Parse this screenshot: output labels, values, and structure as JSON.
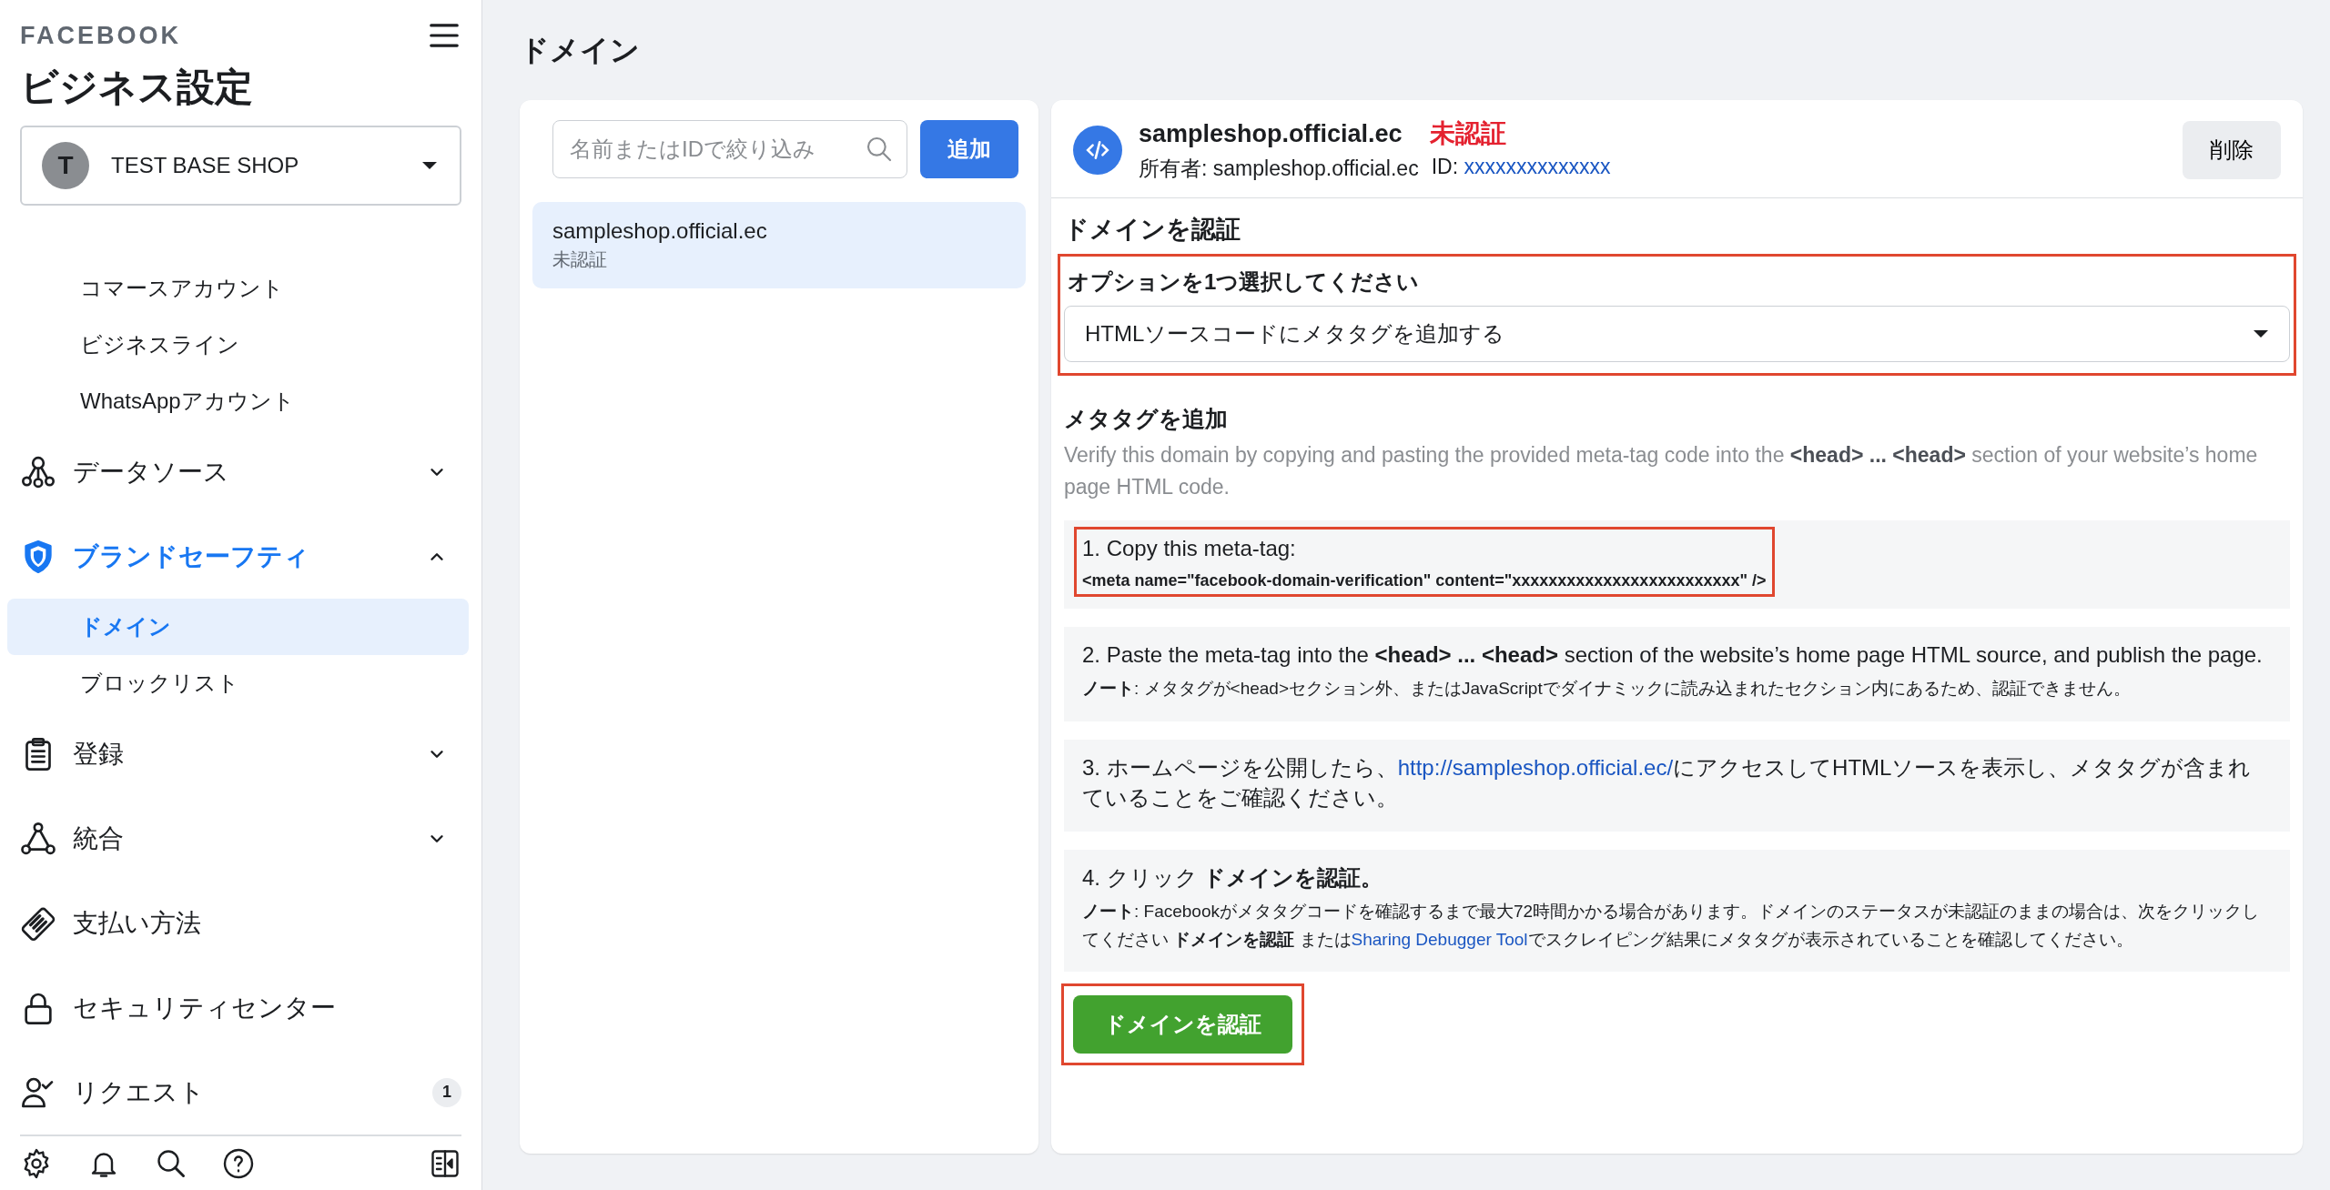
{
  "sidebar": {
    "logo": "FACEBOOK",
    "title": "ビジネス設定",
    "account": {
      "initial": "T",
      "name": "TEST BASE SHOP"
    },
    "items": [
      {
        "kind": "sub",
        "label": "コマースアカウント",
        "selected": false
      },
      {
        "kind": "sub",
        "label": "ビジネスライン",
        "selected": false
      },
      {
        "kind": "sub",
        "label": "WhatsAppアカウント",
        "selected": false
      },
      {
        "kind": "section",
        "label": "データソース",
        "expanded": false,
        "active": false
      },
      {
        "kind": "section",
        "label": "ブランドセーフティ",
        "expanded": true,
        "active": true,
        "children": [
          {
            "label": "ドメイン",
            "selected": true
          },
          {
            "label": "ブロックリスト",
            "selected": false
          }
        ]
      },
      {
        "kind": "section",
        "label": "登録",
        "expanded": false,
        "active": false
      },
      {
        "kind": "section",
        "label": "統合",
        "expanded": false,
        "active": false
      },
      {
        "kind": "link",
        "label": "支払い方法"
      },
      {
        "kind": "link",
        "label": "セキュリティセンター"
      },
      {
        "kind": "link",
        "label": "リクエスト",
        "badge": "1"
      }
    ]
  },
  "page_title": "ドメイン",
  "domain_list": {
    "search": {
      "placeholder": "名前またはIDで絞り込み"
    },
    "add_button": "追加",
    "items": [
      {
        "name": "sampleshop.official.ec",
        "status": "未認証",
        "selected": true
      }
    ]
  },
  "detail": {
    "domain": "sampleshop.official.ec",
    "status": "未認証",
    "owner": "所有者: sampleshop.official.ec",
    "id_label": "ID:",
    "id_value": "xxxxxxxxxxxxxx",
    "delete_button": "削除",
    "verify_heading": "ドメインを認証",
    "option": {
      "label": "オプションを1つ選択してください",
      "value": "HTMLソースコードにメタタグを追加する",
      "highlighted": true
    },
    "method_heading": "メタタグを追加",
    "method_description": "Verify this domain by copying and pasting the provided meta-tag code into the **<head> ... <head>** section of your website’s home page HTML code.",
    "steps": [
      {
        "highlighted": true,
        "text": [
          {
            "kind": "text",
            "text": "1. Copy this meta-tag:"
          }
        ],
        "code": "<meta name=\"facebook-domain-verification\" content=\"xxxxxxxxxxxxxxxxxxxxxxxxx\" />"
      },
      {
        "highlighted": false,
        "text": [
          {
            "kind": "text",
            "text": "2. Paste the meta-tag into the **<head> ... <head>** section of the website’s home page HTML source, and publish the page."
          }
        ],
        "note": [
          {
            "kind": "text",
            "text": "**ノート**: メタタグが<head>セクション外、またはJavaScriptでダイナミックに読み込まれたセクション内にあるため、認証できません。"
          }
        ]
      },
      {
        "highlighted": false,
        "text": [
          {
            "kind": "text",
            "text": "3. ホームページを公開したら、"
          },
          {
            "kind": "link",
            "text": "http://sampleshop.official.ec/"
          },
          {
            "kind": "text",
            "text": "にアクセスしてHTMLソースを表示し、メタタグが含まれていることをご確認ください。"
          }
        ]
      },
      {
        "highlighted": false,
        "text": [
          {
            "kind": "text",
            "text": "4. クリック **ドメインを認証。**"
          }
        ],
        "note": [
          {
            "kind": "text",
            "text": "**ノート**: Facebookがメタタグコードを確認するまで最大72時間かかる場合があります。ドメインのステータスが未認証のままの場合は、次をクリックしてください **ドメインを認証** または"
          },
          {
            "kind": "link",
            "text": "Sharing Debugger Tool"
          },
          {
            "kind": "text",
            "text": "でスクレイピング結果にメタタグが表示されていることを確認してください。"
          }
        ]
      }
    ],
    "verify_button": {
      "label": "ドメインを認証",
      "highlighted": true
    }
  }
}
